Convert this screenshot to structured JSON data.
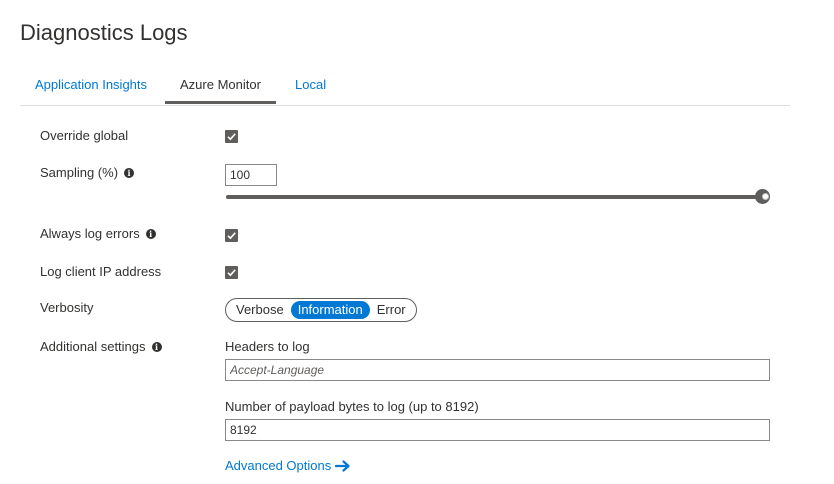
{
  "page": {
    "title": "Diagnostics Logs"
  },
  "tabs": [
    {
      "label": "Application Insights",
      "active": false
    },
    {
      "label": "Azure Monitor",
      "active": true
    },
    {
      "label": "Local",
      "active": false
    }
  ],
  "settings": {
    "override_global": {
      "label": "Override global",
      "checked": true
    },
    "sampling": {
      "label": "Sampling (%)",
      "value": "100",
      "slider_percent": 100,
      "info_icon": "info-icon"
    },
    "always_log_errors": {
      "label": "Always log errors",
      "checked": true,
      "info_icon": "info-icon"
    },
    "log_client_ip": {
      "label": "Log client IP address",
      "checked": true
    },
    "verbosity": {
      "label": "Verbosity",
      "options": [
        "Verbose",
        "Information",
        "Error"
      ],
      "selected": "Information"
    },
    "additional": {
      "label": "Additional settings",
      "info_icon": "info-icon",
      "headers_label": "Headers to log",
      "headers_placeholder": "Accept-Language",
      "headers_value": "",
      "payload_label": "Number of payload bytes to log (up to 8192)",
      "payload_value": "8192",
      "advanced_link": "Advanced Options",
      "advanced_icon": "arrow-right-icon"
    }
  },
  "colors": {
    "accent": "#0078d4",
    "text": "#323130",
    "control": "#605e5c"
  }
}
